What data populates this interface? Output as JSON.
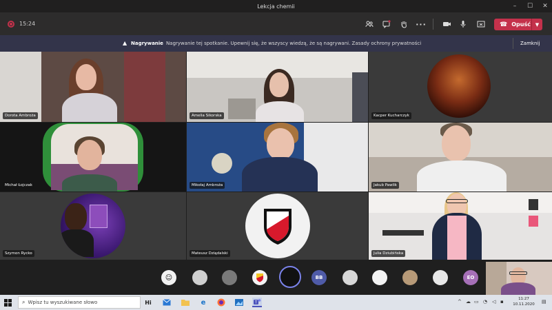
{
  "window": {
    "title": "Lekcja chemii",
    "min": "–",
    "max": "☐",
    "close": "✕"
  },
  "toolbar": {
    "timer": "15:24",
    "leave_label": "Opuść"
  },
  "banner": {
    "strong": "Nagrywanie",
    "text": "Nagrywanie tej spotkanie. Upewnij się, że wszyscy wiedzą, że są nagrywani. Zasady ochrony prywatności",
    "close_label": "Zamknij"
  },
  "participants": [
    {
      "name": "Dorota Ambroża"
    },
    {
      "name": "Amelia Sikorska"
    },
    {
      "name": "Kacper Kucharczyk"
    },
    {
      "name": "Michał Łojczak"
    },
    {
      "name": "Mikołaj Ambroża"
    },
    {
      "name": "Jakub Pawlik"
    },
    {
      "name": "Szymon Rycko"
    },
    {
      "name": "Mateusz Dziądalski"
    },
    {
      "name": "Julia Dziubińska"
    }
  ],
  "avatars": [
    {
      "initials": "",
      "color": "#f2f2f2"
    },
    {
      "initials": "",
      "color": "#cfcfcf"
    },
    {
      "initials": "",
      "color": "#7a7a7a"
    },
    {
      "initials": "",
      "color": "#f4f4f4"
    },
    {
      "initials": "",
      "color": "#111111"
    },
    {
      "initials": "BB",
      "color": "#4f5ba8"
    },
    {
      "initials": "",
      "color": "#d8d8d8"
    },
    {
      "initials": "",
      "color": "#f3f3f3"
    },
    {
      "initials": "",
      "color": "#b79a78"
    },
    {
      "initials": "",
      "color": "#e8e8e8"
    },
    {
      "initials": "EO",
      "color": "#a56fb7"
    }
  ],
  "taskbar": {
    "search_placeholder": "Wpisz tu wyszukiwane słowo",
    "time": "11:27",
    "date": "10.11.2020"
  }
}
